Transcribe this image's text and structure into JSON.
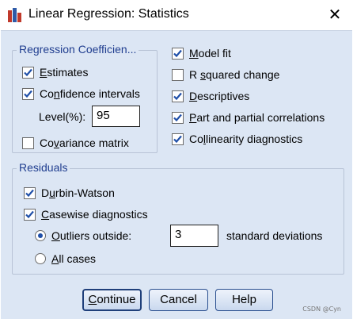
{
  "window": {
    "title": "Linear Regression: Statistics",
    "close_glyph": "✕"
  },
  "regression_coefficients": {
    "legend": "Regression Coefficien...",
    "estimates": {
      "label_ul": "E",
      "label_rest": "stimates",
      "checked": true
    },
    "confidence_intervals": {
      "label_pre": "Co",
      "label_ul": "n",
      "label_rest": "fidence intervals",
      "checked": true
    },
    "level_label": "Level(%):",
    "level_value": "95",
    "covariance_matrix": {
      "label_pre": "Co",
      "label_ul": "v",
      "label_rest": "ariance matrix",
      "checked": false
    }
  },
  "right_options": {
    "model_fit": {
      "label_ul": "M",
      "label_rest": "odel fit",
      "checked": true
    },
    "r_squared_change": {
      "label_pre": "R ",
      "label_ul": "s",
      "label_rest": "quared change",
      "checked": false
    },
    "descriptives": {
      "label_ul": "D",
      "label_rest": "escriptives",
      "checked": true
    },
    "part_partial": {
      "label_ul": "P",
      "label_rest": "art and partial correlations",
      "checked": true
    },
    "collinearity": {
      "label_pre": "Co",
      "label_ul": "l",
      "label_rest": "linearity diagnostics",
      "checked": true
    }
  },
  "residuals": {
    "legend": "Residuals",
    "durbin_watson": {
      "label_pre": "D",
      "label_ul": "u",
      "label_rest": "rbin-Watson",
      "checked": true
    },
    "casewise": {
      "label_ul": "C",
      "label_rest": "asewise diagnostics",
      "checked": true
    },
    "outliers": {
      "label_ul": "O",
      "label_rest": "utliers outside:",
      "selected": true
    },
    "outliers_value": "3",
    "outliers_unit": "standard deviations",
    "all_cases": {
      "label_ul": "A",
      "label_rest": "ll cases",
      "selected": false
    }
  },
  "buttons": {
    "continue": {
      "label_ul": "C",
      "label_rest": "ontinue"
    },
    "cancel": "Cancel",
    "help": "Help"
  },
  "watermark": "CSDN @Cyn",
  "colors": {
    "dialog_bg": "#dce6f4",
    "legend_text": "#1f3d8f",
    "check_mark": "#1f4fa8"
  }
}
